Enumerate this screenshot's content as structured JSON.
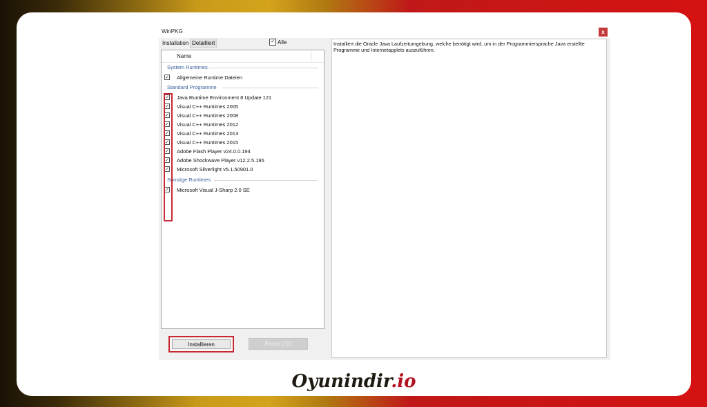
{
  "window": {
    "title": "WinPKG",
    "close_glyph": "x"
  },
  "tabs": [
    {
      "label": "Installation",
      "active": true
    },
    {
      "label": "Detailliert",
      "active": false
    }
  ],
  "select_all": {
    "label": "Alle",
    "checked": true
  },
  "list": {
    "column_header": "Name",
    "groups": [
      {
        "label": "System Runtimes",
        "items": [
          {
            "label": "Allgemeine Runtime Dateien",
            "checked": true
          }
        ]
      },
      {
        "label": "Standard Programme",
        "items": [
          {
            "label": "Java Runtime Environment 8 Update 121",
            "checked": true
          },
          {
            "label": "Visual C++ Runtimes 2005",
            "checked": true
          },
          {
            "label": "Visual C++ Runtimes 2008",
            "checked": true
          },
          {
            "label": "Visual C++ Runtimes 2012",
            "checked": true
          },
          {
            "label": "Visual C++ Runtimes 2013",
            "checked": true
          },
          {
            "label": "Visual C++ Runtimes 2015",
            "checked": true
          },
          {
            "label": "Adobe Flash Player v24.0.0.194",
            "checked": true
          },
          {
            "label": "Adobe Shockwave Player v12.2.5.195",
            "checked": true
          },
          {
            "label": "Microsoft Silverlight v5.1.50901.0",
            "checked": true
          }
        ]
      },
      {
        "label": "Sonstige Runtimes",
        "items": [
          {
            "label": "Microsoft Visual J-Sharp 2.0 SE",
            "checked": true
          }
        ]
      }
    ]
  },
  "description": "Installiert die Oracle Java Laufzeitumgebung, welche benötigt wird, um in der Programmiersprache Java erstellte Programme und Internetapplets auszuführen.",
  "buttons": {
    "install": "Installieren",
    "pause": "Pause (?2)"
  },
  "watermark": {
    "part1": "Oyunindir",
    "part2": ".io"
  },
  "colors": {
    "highlight": "#c8282f",
    "group_text": "#3b5f9a",
    "logo_red": "#b1121f"
  }
}
